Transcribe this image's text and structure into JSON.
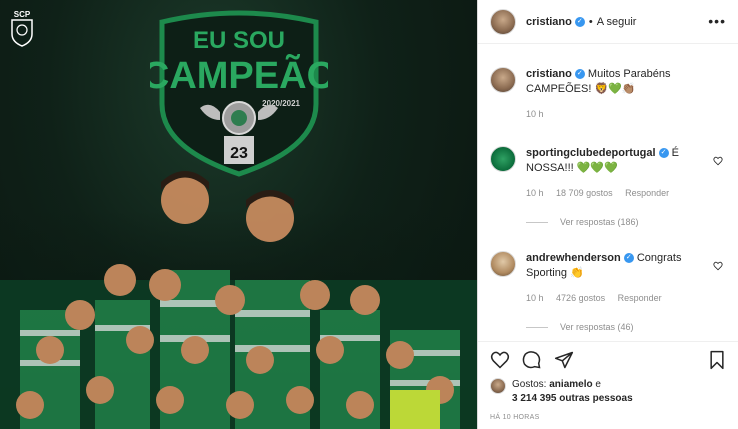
{
  "post": {
    "image_alt": "Eu sou Campeão 2020/2021 Sporting"
  },
  "graphic": {
    "crest_text": "SCP",
    "line1": "EU SOU",
    "line2": "CAMPEÃO",
    "season": "2020/2021",
    "trophy_number": "23",
    "accent": "#1d8a4c"
  },
  "header": {
    "username": "cristiano",
    "separator": "•",
    "follow_label": "A seguir",
    "more_label": "•••"
  },
  "comments": [
    {
      "username": "cristiano",
      "text": "Muitos Parabéns CAMPEÕES! 🦁💚👏🏽",
      "time": "10 h",
      "likes": "",
      "reply": ""
    },
    {
      "username": "sportingclubedeportugal",
      "text": "É NOSSA!!! 💚💚💚",
      "time": "10 h",
      "likes": "18 709 gostos",
      "reply": "Responder",
      "view_replies": "Ver respostas (186)"
    },
    {
      "username": "andrewhenderson",
      "text": "Congrats Sporting 👏",
      "time": "10 h",
      "likes": "4726 gostos",
      "reply": "Responder",
      "view_replies": "Ver respostas (46)"
    }
  ],
  "actions": {
    "likes_prefix": "Gostos:",
    "liker": "aniamelo",
    "likes_join": "e",
    "likes_rest": "3 214 395 outras pessoas",
    "timestamp": "HÁ 10 HORAS"
  },
  "colors": {
    "verified": "#3897f0",
    "muted": "#8e8e8e",
    "text": "#262626"
  }
}
